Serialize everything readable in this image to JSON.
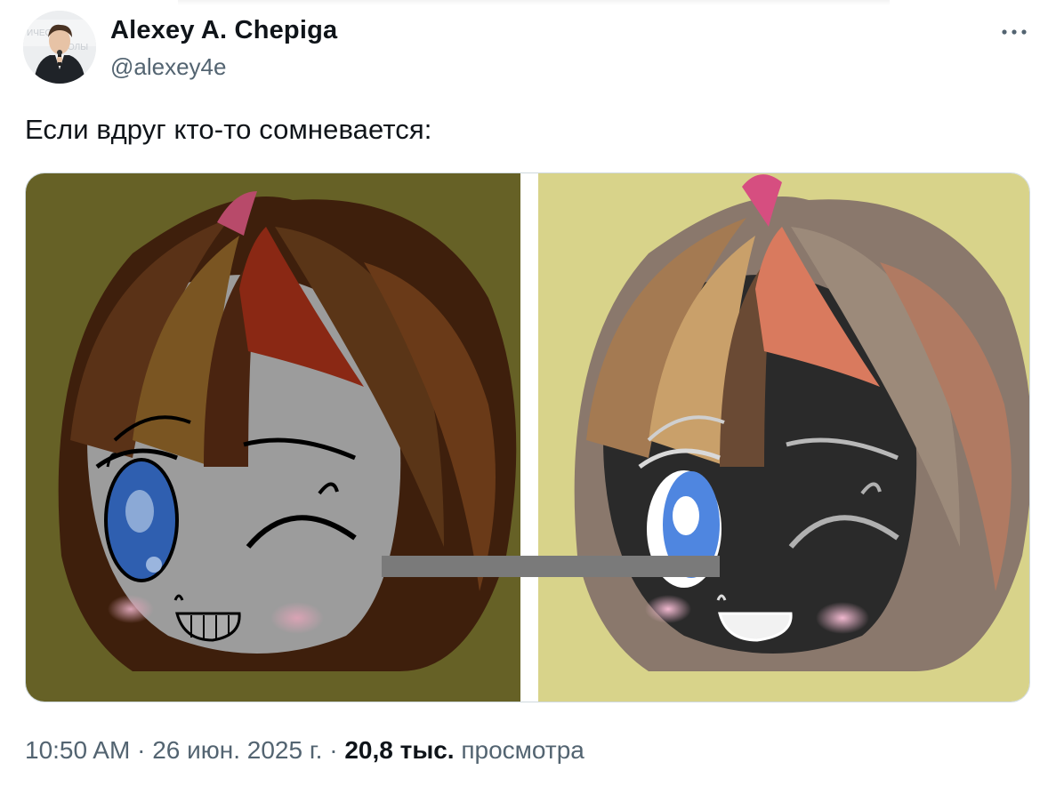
{
  "author": {
    "name": "Alexey A. Chepiga",
    "handle": "@alexey4e"
  },
  "tweet": {
    "text": "Если вдруг кто-то сомневается:"
  },
  "meta": {
    "time": "10:50 AM",
    "separator1": " · ",
    "date": "26 июн. 2025 г.",
    "separator2": " · ",
    "views_count": "20,8 тыс.",
    "views_label": " просмотра"
  },
  "icons": {
    "more": "more-horizontal-icon"
  },
  "colors": {
    "text_primary": "#0f1419",
    "text_secondary": "#536471",
    "left_background": "#666126",
    "right_background": "#d8d38a"
  }
}
